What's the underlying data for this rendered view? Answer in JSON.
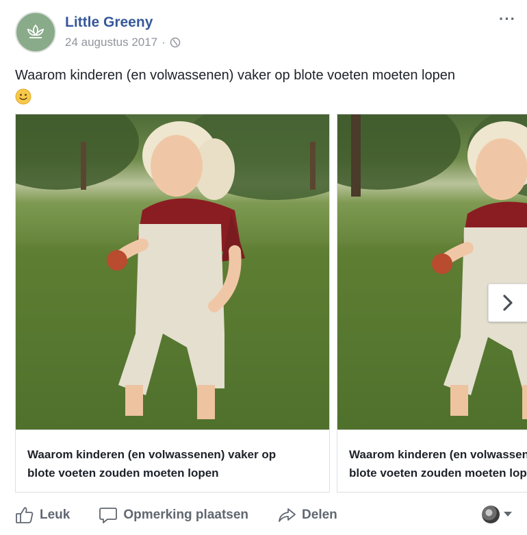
{
  "post": {
    "page_name": "Little Greeny",
    "date": "24 augustus 2017",
    "separator": "·",
    "audience_icon": "globe-icon",
    "more_label": "···",
    "text": "Waarom kinderen (en volwassenen) vaker op blote voeten moeten lopen",
    "emoji": "slightly-smiling-face"
  },
  "carousel": {
    "cards": [
      {
        "caption_line1": "Waarom kinderen (en volwassenen) vaker op",
        "caption_line2": "blote voeten zouden moeten lopen",
        "image": "child-barefoot-grass-photo"
      },
      {
        "caption_line1": "Waarom kinderen (en volwassenen) vaker op",
        "caption_line2": "blote voeten zouden moeten lopen",
        "image": "child-barefoot-grass-photo"
      }
    ],
    "next_icon": "chevron-right-icon"
  },
  "actions": {
    "like": "Leuk",
    "comment": "Opmerking plaatsen",
    "share": "Delen"
  },
  "colors": {
    "link_blue": "#365899",
    "secondary_text": "#90949c",
    "action_gray": "#606770",
    "avatar_green": "#8aab8a"
  }
}
